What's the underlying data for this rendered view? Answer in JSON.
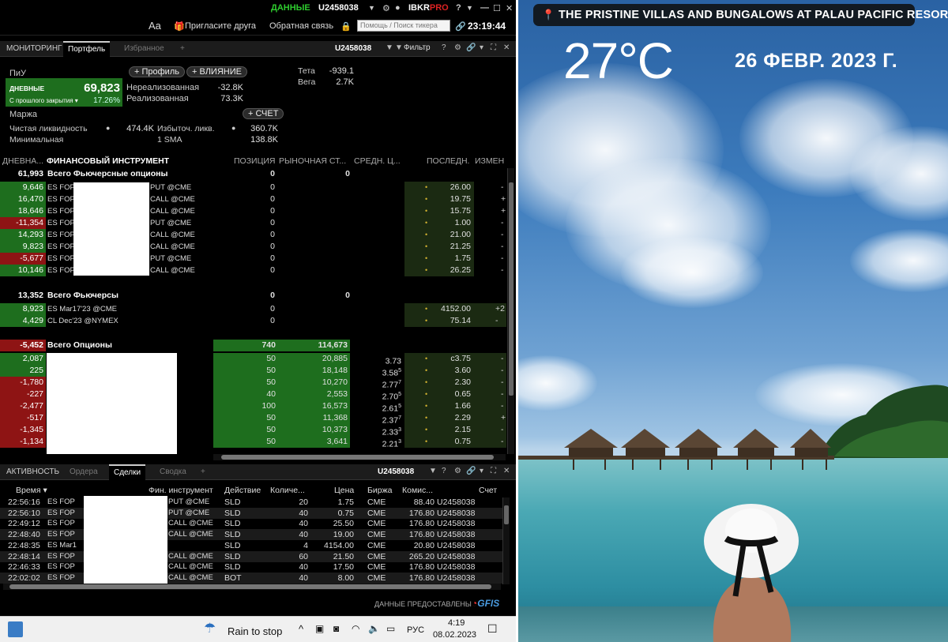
{
  "tws": {
    "topbar": {
      "data_label": "ДАННЫЕ",
      "account": "U2458038",
      "brand_ibkr": "IBKR",
      "brand_pro": "PRO"
    },
    "toolbar": {
      "font_btn": "Aa",
      "invite": "Пригласите друга",
      "feedback": "Обратная связь",
      "search_placeholder": "Помощь / Поиск тикера",
      "clock": "23:19:44"
    },
    "tabs": [
      {
        "label": "МОНИТОРИНГ"
      },
      {
        "label": "Портфель"
      },
      {
        "label": "Избранное"
      },
      {
        "label": "+"
      }
    ],
    "tabbar_right": {
      "account": "U2458038",
      "filter": "Фильтр",
      "help": "?"
    },
    "summary": {
      "pnl_title": "ПиУ",
      "profile_btn": "+ Профиль",
      "impact_btn": "+ ВЛИЯНИЕ",
      "daily_label": "ДНЕВНЫЕ",
      "daily_value": "69,823",
      "since_close_label": "С прошлого закрытия",
      "since_close_pct": "17.26%",
      "unrealized_label": "Нереализованная",
      "unrealized_value": "-32.8K",
      "realized_label": "Реализованная",
      "realized_value": "73.3K",
      "theta_label": "Тета",
      "theta_value": "-939.1",
      "vega_label": "Вега",
      "vega_value": "2.7K",
      "margin_title": "Маржа",
      "account_btn": "+ СЧЕТ",
      "net_liq_label": "Чистая ликвидность",
      "net_liq_value": "474.4K",
      "excess_liq_label": "Избыточ. ликв.",
      "excess_liq_value": "360.7K",
      "min_label": "Минимальная",
      "sma_label": "1 SMA",
      "sma_value": "138.8K"
    },
    "grid_headers": {
      "daily": "ДНЕВНА...",
      "instrument": "ФИНАНСОВЫЙ ИНСТРУМЕНТ",
      "position": "ПОЗИЦИЯ",
      "market": "РЫНОЧНАЯ СТ...",
      "avg": "СРЕДН. Ц...",
      "last": "ПОСЛЕДН.",
      "change": "ИЗМЕН"
    },
    "groups": {
      "fop": {
        "daily": "61,993",
        "name": "Всего Фьючерсные опционы",
        "position": "0",
        "market": "0"
      },
      "fut": {
        "daily": "13,352",
        "name": "Всего Фьючерсы",
        "position": "0",
        "market": "0"
      },
      "opt": {
        "daily": "-5,452",
        "name": "Всего Опционы",
        "position": "740",
        "market": "114,673"
      }
    },
    "fop_rows": [
      {
        "daily": "9,646",
        "a": "ES FOP",
        "b": "PUT @CME",
        "pos": "0",
        "last": "26.00",
        "chg": "-",
        "neg": false
      },
      {
        "daily": "16,470",
        "a": "ES FOP",
        "b": "CALL @CME",
        "pos": "0",
        "last": "19.75",
        "chg": "+",
        "neg": false
      },
      {
        "daily": "18,646",
        "a": "ES FOP",
        "b": "CALL @CME",
        "pos": "0",
        "last": "15.75",
        "chg": "+",
        "neg": false
      },
      {
        "daily": "-11,354",
        "a": "ES FOP",
        "b": "PUT @CME",
        "pos": "0",
        "last": "1.00",
        "chg": "-",
        "neg": true
      },
      {
        "daily": "14,293",
        "a": "ES FOP",
        "b": "CALL @CME",
        "pos": "0",
        "last": "21.00",
        "chg": "-",
        "neg": false
      },
      {
        "daily": "9,823",
        "a": "ES FOP",
        "b": "CALL @CME",
        "pos": "0",
        "last": "21.25",
        "chg": "-",
        "neg": false
      },
      {
        "daily": "-5,677",
        "a": "ES FOP",
        "b": "PUT @CME",
        "pos": "0",
        "last": "1.75",
        "chg": "-",
        "neg": true
      },
      {
        "daily": "10,146",
        "a": "ES FOP",
        "b": "CALL @CME",
        "pos": "0",
        "last": "26.25",
        "chg": "-",
        "neg": false
      }
    ],
    "fut_rows": [
      {
        "daily": "8,923",
        "name": "ES Mar17'23 @CME",
        "pos": "0",
        "last": "4152.00",
        "chg": "+2"
      },
      {
        "daily": "4,429",
        "name": "CL Dec'23 @NYMEX",
        "pos": "0",
        "last": "75.14",
        "chg": "-"
      }
    ],
    "opt_rows": [
      {
        "daily": "2,087",
        "pos": "50",
        "mkt": "20,885",
        "avg": "3.73",
        "sup": "",
        "last": "c3.75",
        "chg": "-",
        "neg": false
      },
      {
        "daily": "225",
        "pos": "50",
        "mkt": "18,148",
        "avg": "3.58",
        "sup": "5",
        "last": "3.60",
        "chg": "-",
        "neg": false
      },
      {
        "daily": "-1,780",
        "pos": "50",
        "mkt": "10,270",
        "avg": "2.77",
        "sup": "7",
        "last": "2.30",
        "chg": "-",
        "neg": true
      },
      {
        "daily": "-227",
        "pos": "40",
        "mkt": "2,553",
        "avg": "2.70",
        "sup": "5",
        "last": "0.65",
        "chg": "-",
        "neg": true
      },
      {
        "daily": "-2,477",
        "pos": "100",
        "mkt": "16,573",
        "avg": "2.61",
        "sup": "5",
        "last": "1.66",
        "chg": "-",
        "neg": true
      },
      {
        "daily": "-517",
        "pos": "50",
        "mkt": "11,368",
        "avg": "2.37",
        "sup": "7",
        "last": "2.29",
        "chg": "+",
        "neg": true
      },
      {
        "daily": "-1,345",
        "pos": "50",
        "mkt": "10,373",
        "avg": "2.33",
        "sup": "3",
        "last": "2.15",
        "chg": "-",
        "neg": true
      },
      {
        "daily": "-1,134",
        "pos": "50",
        "mkt": "3,641",
        "avg": "2.21",
        "sup": "3",
        "last": "0.75",
        "chg": "-",
        "neg": true
      }
    ],
    "act_tabs": [
      {
        "label": "АКТИВНОСТЬ"
      },
      {
        "label": "Ордера"
      },
      {
        "label": "Сделки"
      },
      {
        "label": "Сводка"
      },
      {
        "label": "+"
      }
    ],
    "act_account": "U2458038",
    "trade_headers": {
      "time": "Время",
      "instrument": "Фин. инструмент",
      "action": "Действие",
      "qty": "Количе...",
      "price": "Цена",
      "exchange": "Биржа",
      "commission": "Комис...",
      "account": "Счет"
    },
    "trades": [
      {
        "time": "22:56:16",
        "a": "ES FOP",
        "b": "PUT @CME",
        "act": "SLD",
        "qty": "20",
        "price": "1.75",
        "exch": "CME",
        "comm": "88.40",
        "acct": "U2458038"
      },
      {
        "time": "22:56:10",
        "a": "ES FOP",
        "b": "PUT @CME",
        "act": "SLD",
        "qty": "40",
        "price": "0.75",
        "exch": "CME",
        "comm": "176.80",
        "acct": "U2458038"
      },
      {
        "time": "22:49:12",
        "a": "ES FOP",
        "b": "CALL @CME",
        "act": "SLD",
        "qty": "40",
        "price": "25.50",
        "exch": "CME",
        "comm": "176.80",
        "acct": "U2458038"
      },
      {
        "time": "22:48:40",
        "a": "ES FOP",
        "b": "CALL @CME",
        "act": "SLD",
        "qty": "40",
        "price": "19.00",
        "exch": "CME",
        "comm": "176.80",
        "acct": "U2458038"
      },
      {
        "time": "22:48:35",
        "a": "ES Mar1",
        "b": "",
        "act": "SLD",
        "qty": "4",
        "price": "4154.00",
        "exch": "CME",
        "comm": "20.80",
        "acct": "U2458038"
      },
      {
        "time": "22:48:14",
        "a": "ES FOP",
        "b": "CALL @CME",
        "act": "SLD",
        "qty": "60",
        "price": "21.50",
        "exch": "CME",
        "comm": "265.20",
        "acct": "U2458038"
      },
      {
        "time": "22:46:33",
        "a": "ES FOP",
        "b": "CALL @CME",
        "act": "SLD",
        "qty": "40",
        "price": "17.50",
        "exch": "CME",
        "comm": "176.80",
        "acct": "U2458038"
      },
      {
        "time": "22:02:02",
        "a": "ES FOP",
        "b": "CALL @CME",
        "act": "BOT",
        "qty": "40",
        "price": "8.00",
        "exch": "CME",
        "comm": "176.80",
        "acct": "U2458038"
      }
    ],
    "data_provided": "ДАННЫЕ ПРЕДОСТАВЛЕНЫ",
    "gfis": "GFIS",
    "taskbar": {
      "weather": "Rain to stop",
      "lang": "РУС",
      "time": "4:19",
      "date": "08.02.2023"
    }
  },
  "photo": {
    "location": "THE PRISTINE VILLAS AND BUNGALOWS AT PALAU PACIFIC RESORT",
    "temperature": "27°C",
    "date": "26 ФЕВР. 2023 Г."
  }
}
